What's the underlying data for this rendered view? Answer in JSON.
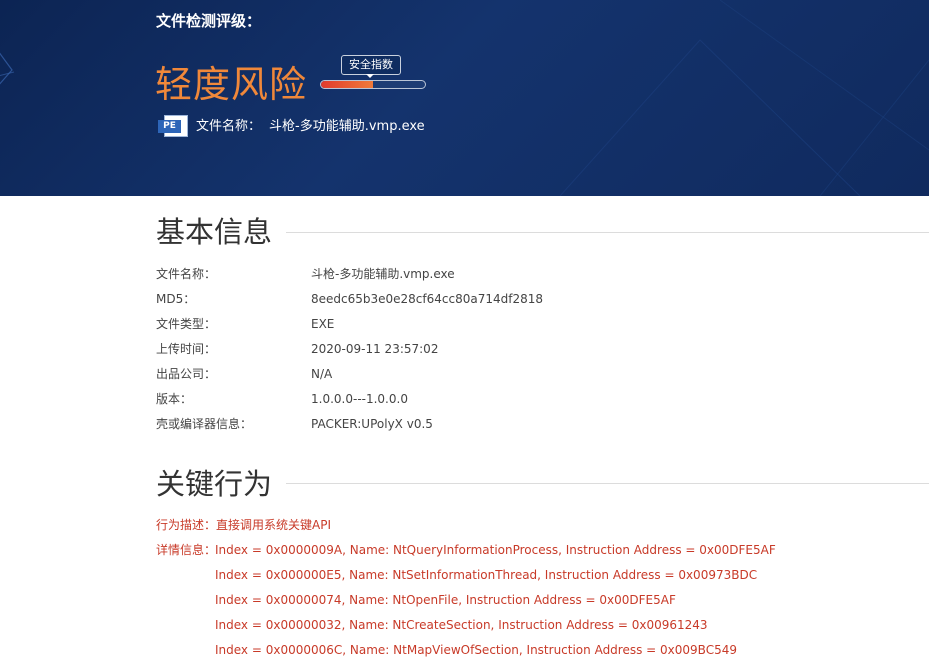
{
  "header": {
    "rating_title": "文件检测评级：",
    "risk_level": "轻度风险",
    "safety_index_label": "安全指数",
    "safety_index_fraction": 0.5,
    "file_icon_text": "PE",
    "file_name_label": "文件名称：",
    "file_name": "斗枪-多功能辅助.vmp.exe"
  },
  "basic_info": {
    "heading": "基本信息",
    "rows": [
      {
        "label": "文件名称：",
        "value": "斗枪-多功能辅助.vmp.exe"
      },
      {
        "label": "MD5：",
        "value": "8eedc65b3e0e28cf64cc80a714df2818"
      },
      {
        "label": "文件类型：",
        "value": "EXE"
      },
      {
        "label": "上传时间：",
        "value": "2020-09-11 23:57:02"
      },
      {
        "label": "出品公司：",
        "value": "N/A"
      },
      {
        "label": "版本：",
        "value": "1.0.0.0---1.0.0.0"
      },
      {
        "label": "壳或编译器信息：",
        "value": "PACKER:UPolyX v0.5"
      }
    ]
  },
  "key_behavior": {
    "heading": "关键行为",
    "description": "行为描述：直接调用系统关键API",
    "detail_label": "详情信息：",
    "details": [
      "Index = 0x0000009A, Name: NtQueryInformationProcess, Instruction Address = 0x00DFE5AF",
      "Index = 0x000000E5, Name: NtSetInformationThread, Instruction Address = 0x00973BDC",
      "Index = 0x00000074, Name: NtOpenFile, Instruction Address = 0x00DFE5AF",
      "Index = 0x00000032, Name: NtCreateSection, Instruction Address = 0x00961243",
      "Index = 0x0000006C, Name: NtMapViewOfSection, Instruction Address = 0x009BC549"
    ]
  },
  "colors": {
    "banner_background": "#102a5e",
    "risk_accent": "#f0883a",
    "behavior_text": "#c83a28"
  }
}
